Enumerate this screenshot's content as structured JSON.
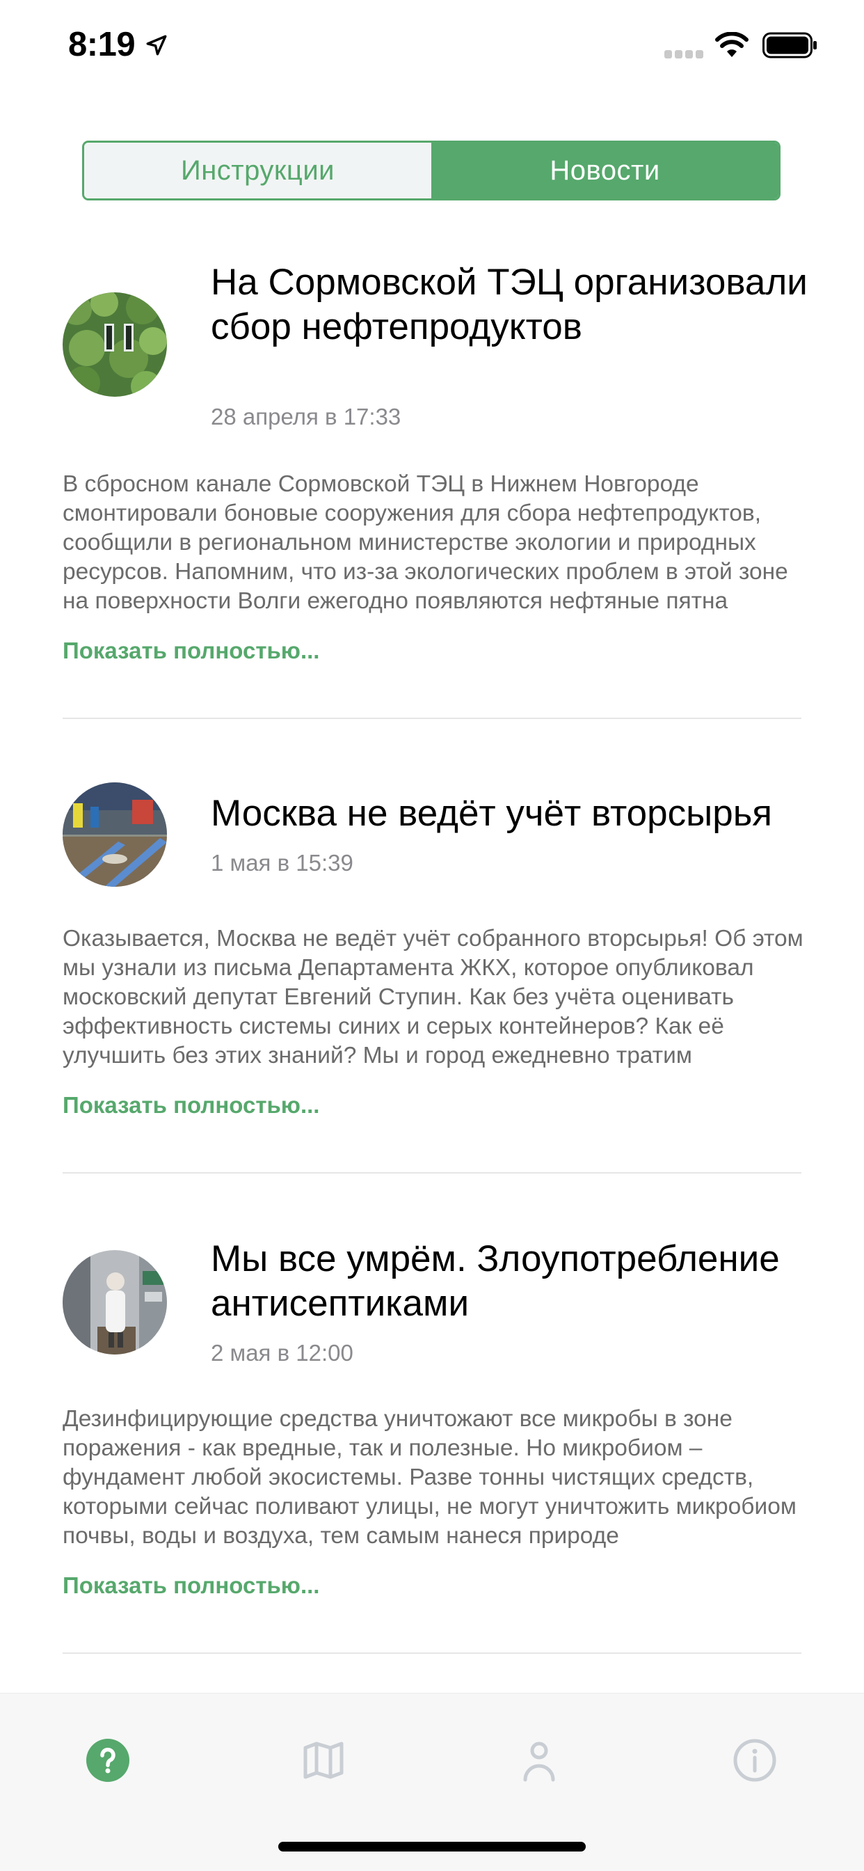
{
  "status_bar": {
    "time": "8:19",
    "icons": [
      "location-arrow-icon",
      "signal-icon",
      "wifi-icon",
      "battery-icon"
    ]
  },
  "segmented_control": {
    "tabs": [
      {
        "label": "Инструкции",
        "selected": false
      },
      {
        "label": "Новости",
        "selected": true
      }
    ]
  },
  "news": [
    {
      "title": "На Сормовской ТЭЦ организовали сбор нефтепродуктов",
      "date": "28 апреля в 17:33",
      "body": "В сбросном канале Сормовской ТЭЦ в Нижнем Новгороде смонтировали боновые сооружения для сбора нефтепродуктов, сообщили в региональном министерстве экологии и природных ресурсов. Напомним, что из-за экологических проблем в этой зоне на поверхности Волги ежегодно появляются нефтяные пятна",
      "more": "Показать полностью..."
    },
    {
      "title": "Москва не ведёт учёт вторсырья",
      "date": "1 мая в 15:39",
      "body": "Оказывается, Москва не ведёт учёт собранного вторсырья! Об этом мы узнали из письма Департамента ЖКХ, которое опубликовал московский депутат Евгений Ступин.  Как без учёта оценивать эффективность системы синих и серых контейнеров? Как её улучшить без этих знаний? Мы и город ежедневно тратим",
      "more": "Показать полностью..."
    },
    {
      "title": "Мы все умрём. Злоупотребление антисептиками",
      "date": "2 мая в 12:00",
      "body": "Дезинфицирующие средства уничтожают все микробы в зоне поражения - как вредные, так и полезные. Но микробиом – фундамент любой экосистемы. Разве тонны чистящих средств, которыми сейчас поливают улицы, не могут уничтожить микробиом почвы, воды и воздуха, тем самым нанеся природе",
      "more": "Показать полностью..."
    }
  ],
  "tab_bar": {
    "items": [
      {
        "icon": "question-circle-icon",
        "active": true
      },
      {
        "icon": "map-icon",
        "active": false
      },
      {
        "icon": "person-icon",
        "active": false
      },
      {
        "icon": "info-circle-icon",
        "active": false
      }
    ]
  },
  "colors": {
    "accent": "#56a86c",
    "inactive_icon": "#c9ced4",
    "secondary_text": "#8a8a8e",
    "body_text": "#6b6b6b"
  }
}
